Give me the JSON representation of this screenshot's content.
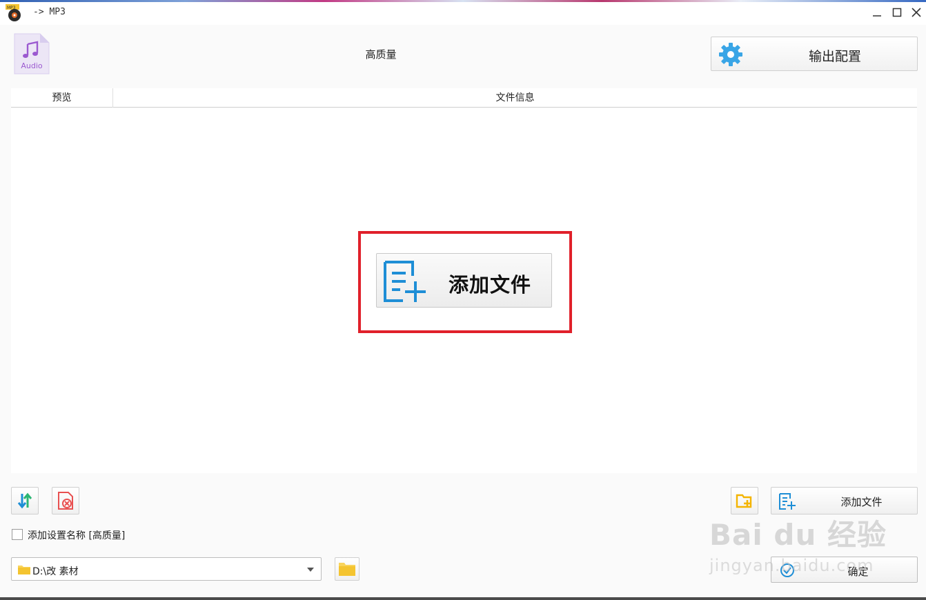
{
  "window": {
    "title": "-> MP3",
    "app_icon_text": "MP3"
  },
  "header": {
    "format_icon_label": "Audio",
    "quality": "高质量",
    "output_config_label": "输出配置"
  },
  "file_list": {
    "columns": [
      "预览",
      "文件信息"
    ]
  },
  "center": {
    "add_file_label": "添加文件"
  },
  "bottom": {
    "add_file_label": "添加文件",
    "add_name_checkbox_label": "添加设置名称 [高质量]",
    "add_name_checked": false,
    "output_path": "D:\\改  素材",
    "confirm_label": "确定"
  },
  "watermark": {
    "brand": "Bai du 经验",
    "url": "jingyan.baidu.com"
  },
  "colors": {
    "accent_blue": "#1e8ed6",
    "gear_blue": "#39a5e6",
    "highlight_red": "#e0202a",
    "folder_yellow": "#f4c430",
    "delete_red": "#e85050",
    "audio_purple": "#9b59d0"
  }
}
